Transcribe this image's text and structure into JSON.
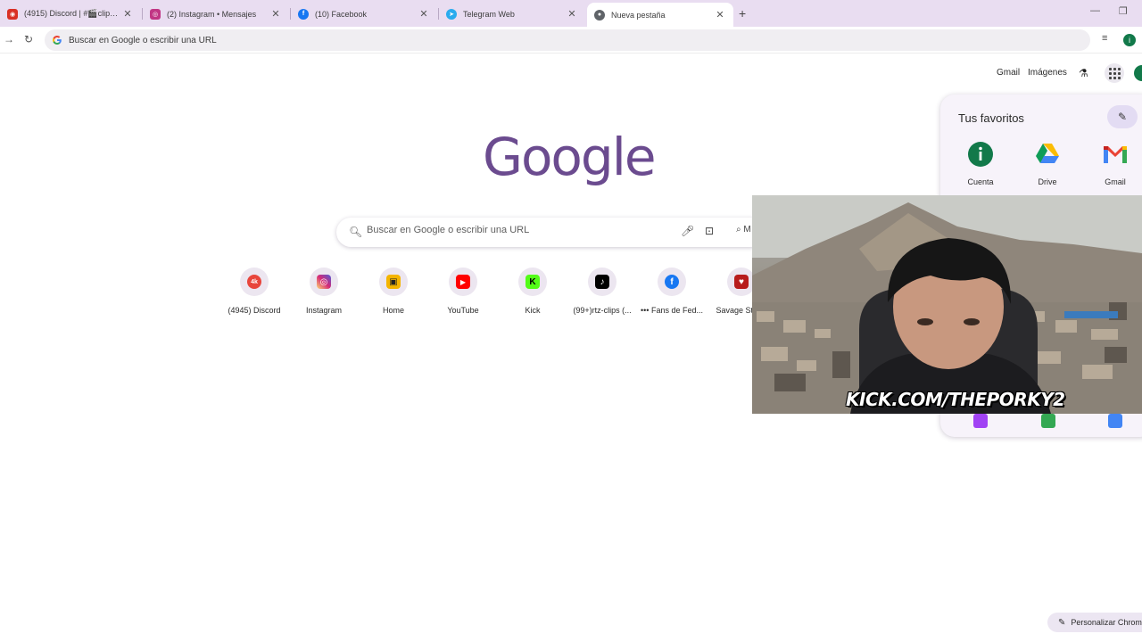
{
  "tabs": [
    {
      "title": "(4915) Discord | #🎬clips🎬 | Ꭺ",
      "icon": "discord-icon",
      "color": "#d93025",
      "active": false
    },
    {
      "title": "(2) Instagram • Mensajes",
      "icon": "instagram-icon",
      "color": "#c13584",
      "active": false
    },
    {
      "title": "(10) Facebook",
      "icon": "facebook-icon",
      "color": "#1877f2",
      "active": false
    },
    {
      "title": "Telegram Web",
      "icon": "telegram-icon",
      "color": "#2aabee",
      "active": false
    },
    {
      "title": "Nueva pestaña",
      "icon": "chrome-icon",
      "color": "#5f6368",
      "active": true
    }
  ],
  "toolbar": {
    "omnibox_text": "Buscar en Google o escribir una URL",
    "profile_initial": "i"
  },
  "header": {
    "gmail": "Gmail",
    "images": "Imágenes"
  },
  "logo_text": "Google",
  "search": {
    "placeholder": "Buscar en Google o escribir una URL",
    "ai_label": "M"
  },
  "shortcuts": [
    {
      "label": "(4945) Discord",
      "icon": "discord-icon",
      "color": "#e8453c",
      "glyph": "4k"
    },
    {
      "label": "Instagram",
      "icon": "instagram-icon",
      "color": "#d6249f",
      "glyph": "◎"
    },
    {
      "label": "Home",
      "icon": "home-icon",
      "color": "#f4b400",
      "glyph": "▣"
    },
    {
      "label": "YouTube",
      "icon": "youtube-icon",
      "color": "#ff0000",
      "glyph": "▶"
    },
    {
      "label": "Kick",
      "icon": "kick-icon",
      "color": "#53fc18",
      "glyph": "K"
    },
    {
      "label": "(99+)rtz-clips (...",
      "icon": "tiktok-icon",
      "color": "#000000",
      "glyph": "♪"
    },
    {
      "label": "••• Fans de Fed...",
      "icon": "facebook-icon",
      "color": "#1877f2",
      "glyph": "f"
    },
    {
      "label": "Savage Stre...",
      "icon": "savage-icon",
      "color": "#b71c1c",
      "glyph": "♥"
    }
  ],
  "favorites": {
    "title": "Tus favoritos",
    "apps": [
      {
        "label": "Cuenta",
        "icon": "account-icon"
      },
      {
        "label": "Drive",
        "icon": "drive-icon"
      },
      {
        "label": "Gmail",
        "icon": "gmail-icon"
      }
    ]
  },
  "webcam": {
    "overlay_text": "KICK.COM/THEPORKY2"
  },
  "customize_label": "Personalizar Chrome"
}
